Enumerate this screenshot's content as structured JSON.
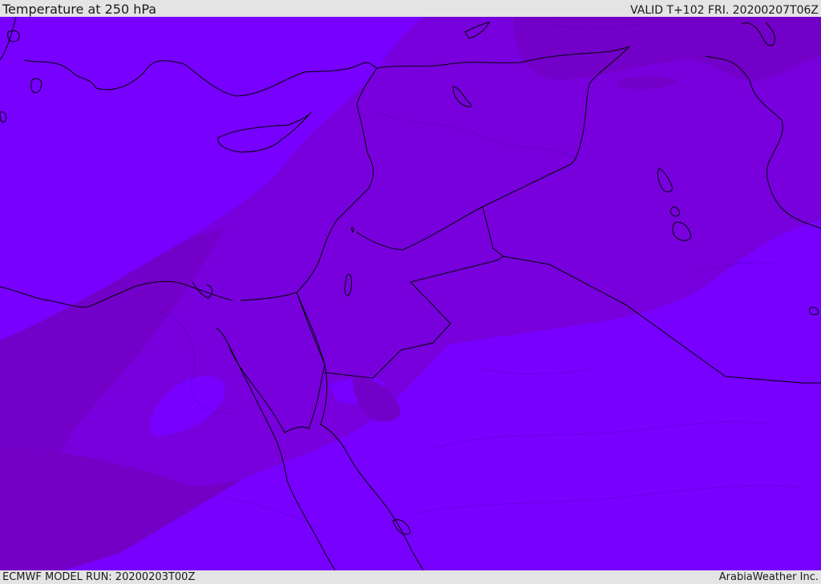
{
  "header": {
    "title": "Temperature at 250 hPa",
    "valid": "VALID T+102 FRI. 20200207T06Z"
  },
  "footer": {
    "model_run": "ECMWF MODEL RUN: 20200203T00Z",
    "credit": "ArabiaWeather Inc."
  },
  "map": {
    "field": "temperature",
    "level": "250 hPa",
    "colors": {
      "cold_band": "#7700ff",
      "mid_band": "#7700dd",
      "warm_band": "#7300c4",
      "coastline": "#000000",
      "border": "#000000"
    }
  }
}
